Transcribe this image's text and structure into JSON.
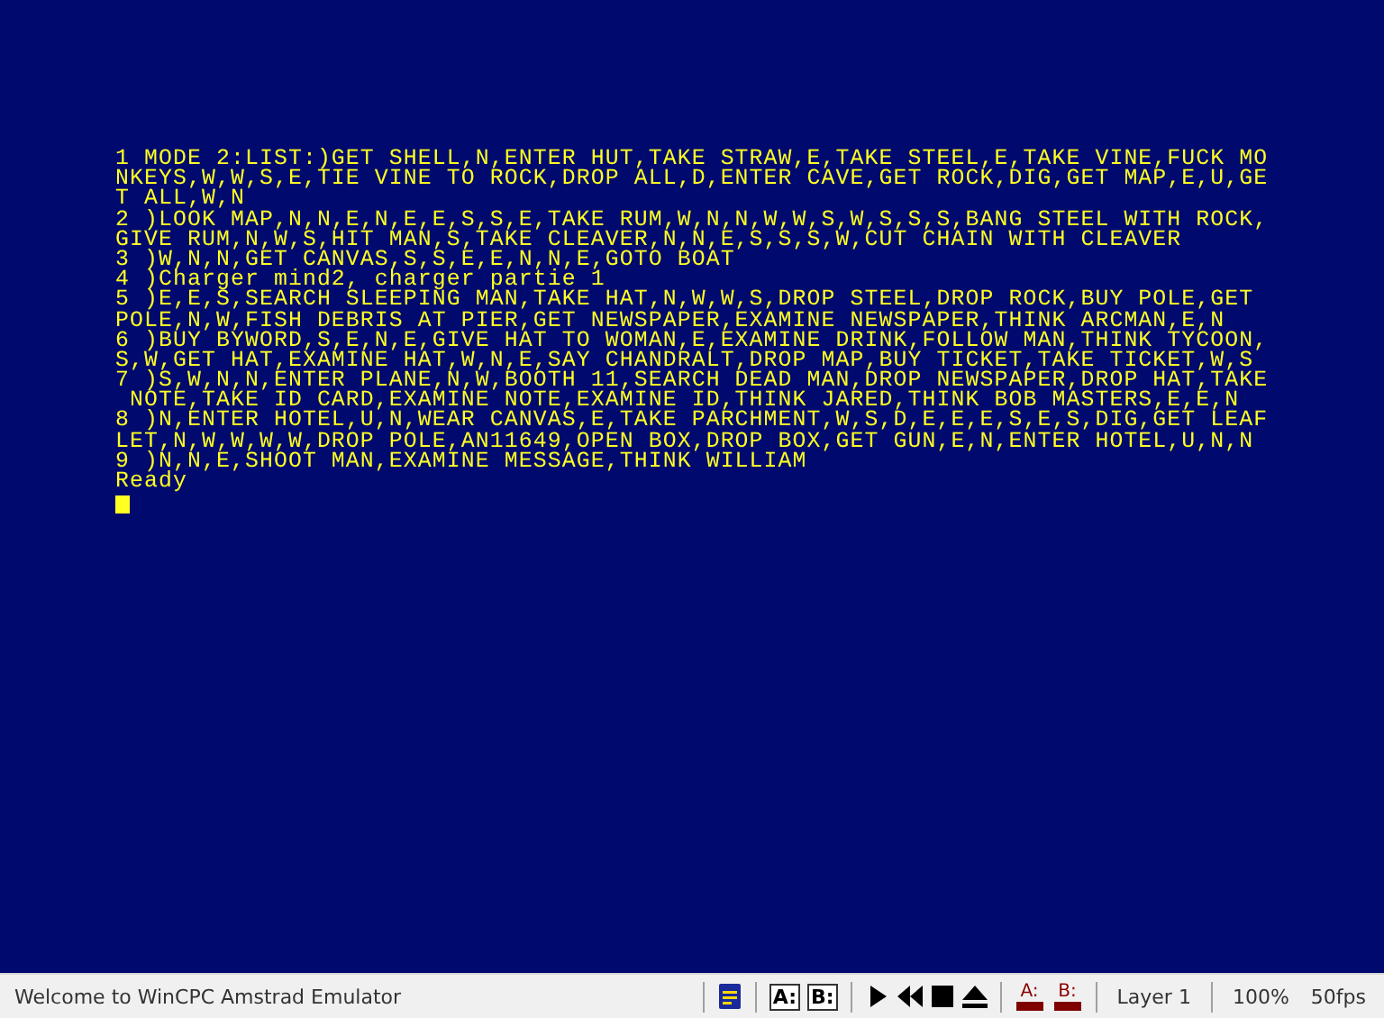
{
  "screen": {
    "lines": [
      "1 MODE 2:LIST:)GET SHELL,N,ENTER HUT,TAKE STRAW,E,TAKE STEEL,E,TAKE VINE,FUCK MO",
      "NKEYS,W,W,S,E,TIE VINE TO ROCK,DROP ALL,D,ENTER CAVE,GET ROCK,DIG,GET MAP,E,U,GE",
      "T ALL,W,N",
      "2 )LOOK MAP,N,N,E,N,E,E,S,S,E,TAKE RUM,W,N,N,W,W,S,W,S,S,S,BANG STEEL WITH ROCK,",
      "GIVE RUM,N,W,S,HIT MAN,S,TAKE CLEAVER,N,N,E,S,S,S,W,CUT CHAIN WITH CLEAVER",
      "3 )W,N,N,GET CANVAS,S,S,E,E,N,N,E,GOTO BOAT",
      "4 )Charger mind2, charger partie 1",
      "5 )E,E,S,SEARCH SLEEPING MAN,TAKE HAT,N,W,W,S,DROP STEEL,DROP ROCK,BUY POLE,GET",
      "POLE,N,W,FISH DEBRIS AT PIER,GET NEWSPAPER,EXAMINE NEWSPAPER,THINK ARCMAN,E,N",
      "6 )BUY BYWORD,S,E,N,E,GIVE HAT TO WOMAN,E,EXAMINE DRINK,FOLLOW MAN,THINK TYCOON,",
      "S,W,GET HAT,EXAMINE HAT,W,N,E,SAY CHANDRALT,DROP MAP,BUY TICKET,TAKE TICKET,W,S",
      "7 )S,W,N,N,ENTER PLANE,N,W,BOOTH 11,SEARCH DEAD MAN,DROP NEWSPAPER,DROP HAT,TAKE",
      " NOTE,TAKE ID CARD,EXAMINE NOTE,EXAMINE ID,THINK JARED,THINK BOB MASTERS,E,E,N",
      "8 )N,ENTER HOTEL,U,N,WEAR CANVAS,E,TAKE PARCHMENT,W,S,D,E,E,E,S,E,S,DIG,GET LEAF",
      "LET,N,W,W,W,W,DROP POLE,AN11649,OPEN BOX,DROP BOX,GET GUN,E,N,ENTER HOTEL,U,N,N",
      "9 )N,N,E,SHOOT MAN,EXAMINE MESSAGE,THINK WILLIAM",
      "Ready"
    ],
    "cursor": true
  },
  "status_bar": {
    "message": "Welcome to WinCPC Amstrad Emulator",
    "drive_buttons": [
      "A:",
      "B:"
    ],
    "drive_leds": [
      {
        "label": "A:"
      },
      {
        "label": "B:"
      }
    ],
    "layer": "Layer 1",
    "zoom": "100%",
    "fps": "50fps"
  }
}
